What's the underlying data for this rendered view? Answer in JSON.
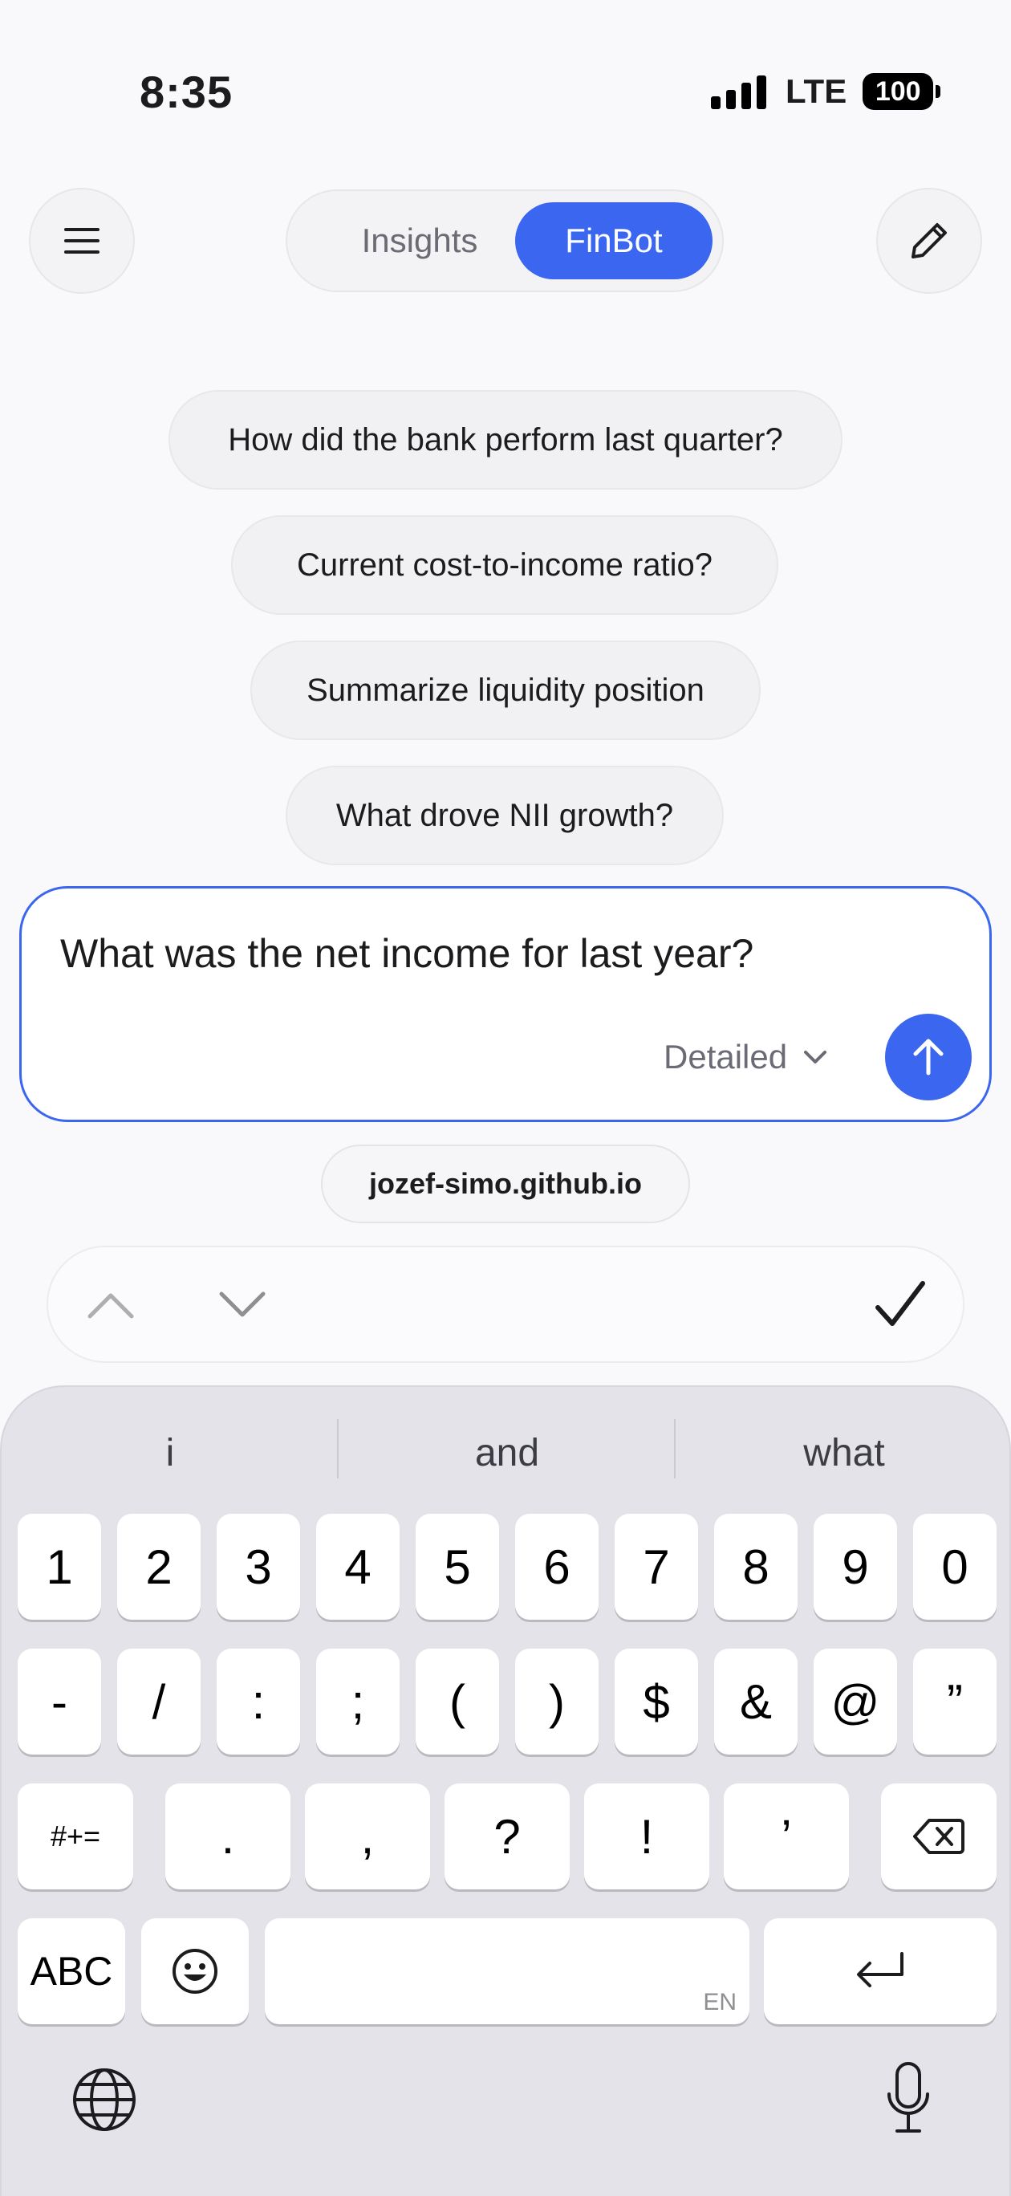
{
  "status_bar": {
    "time": "8:35",
    "network": "LTE",
    "battery": "100"
  },
  "nav": {
    "menu_icon": "hamburger-menu-icon",
    "tabs": [
      {
        "label": "Insights",
        "active": false
      },
      {
        "label": "FinBot",
        "active": true
      }
    ],
    "edit_icon": "pencil-icon"
  },
  "suggestions": [
    "How did the bank perform last quarter?",
    "Current cost-to-income ratio?",
    "Summarize liquidity position",
    "What drove NII growth?"
  ],
  "composer": {
    "value": "What was the net income for last year?",
    "mode_label": "Detailed",
    "send_icon": "arrow-up-icon"
  },
  "browser": {
    "url": "jozef-simo.github.io"
  },
  "keyboard": {
    "predictions": [
      "i",
      "and",
      "what"
    ],
    "row1": [
      "1",
      "2",
      "3",
      "4",
      "5",
      "6",
      "7",
      "8",
      "9",
      "0"
    ],
    "row2": [
      "-",
      "/",
      ":",
      ";",
      "(",
      ")",
      "$",
      "&",
      "@",
      "”"
    ],
    "row3": [
      "#+=",
      ".",
      ",",
      "?",
      "!",
      "’"
    ],
    "abc_label": "ABC",
    "space_lang": "EN"
  },
  "colors": {
    "accent": "#3A66F0",
    "background": "#F9F8FA",
    "keyboard": "#E3E3E9"
  }
}
